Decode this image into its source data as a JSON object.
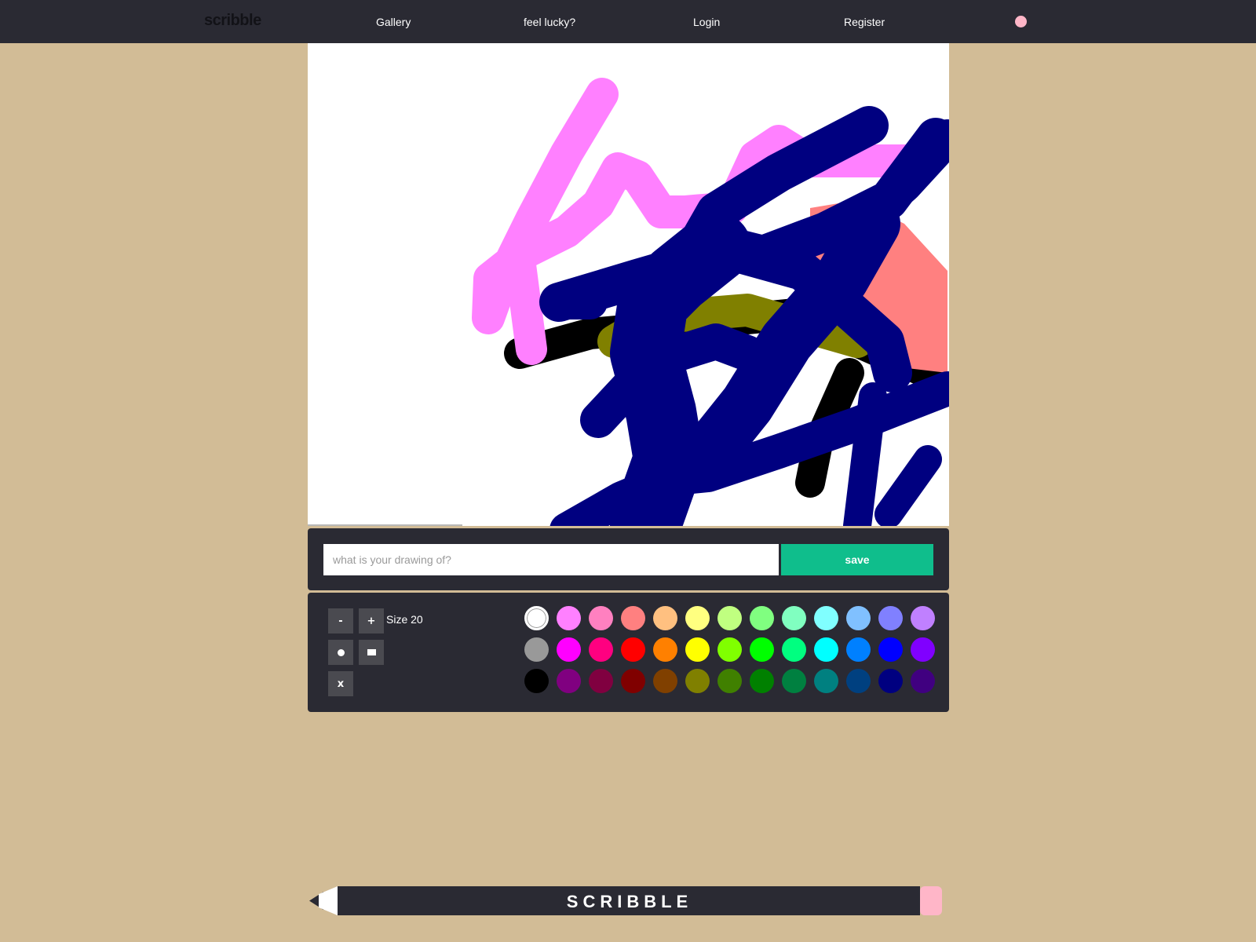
{
  "nav": {
    "brand": "scribble",
    "links": [
      {
        "label": "Gallery"
      },
      {
        "label": "feel lucky?"
      },
      {
        "label": "Login"
      },
      {
        "label": "Register"
      }
    ],
    "dot_color": "#ffb6c8"
  },
  "save_bar": {
    "placeholder": "what is your drawing of?",
    "value": "",
    "save_label": "save"
  },
  "tools": {
    "decrease_label": "-",
    "increase_label": "+",
    "size_label": "Size 20",
    "round_brush_icon": "round-brush-icon",
    "square_brush_icon": "square-brush-icon",
    "clear_label": "x"
  },
  "palette": {
    "selected_color": "#ffffff",
    "rows": [
      [
        "#ffffff",
        "#ff80ff",
        "#ff80c0",
        "#ff8080",
        "#ffc080",
        "#ffff80",
        "#c0ff80",
        "#80ff80",
        "#80ffc0",
        "#80ffff",
        "#80c0ff",
        "#8080ff",
        "#c080ff"
      ],
      [
        "#999999",
        "#ff00ff",
        "#ff0080",
        "#ff0000",
        "#ff8000",
        "#ffff00",
        "#80ff00",
        "#00ff00",
        "#00ff80",
        "#00ffff",
        "#0080ff",
        "#0000ff",
        "#8000ff"
      ],
      [
        "#000000",
        "#800080",
        "#800040",
        "#800000",
        "#804000",
        "#808000",
        "#408000",
        "#008000",
        "#008040",
        "#008080",
        "#004080",
        "#000080",
        "#400080"
      ]
    ]
  },
  "footer": {
    "logo_text": "SCRIBBLE"
  }
}
